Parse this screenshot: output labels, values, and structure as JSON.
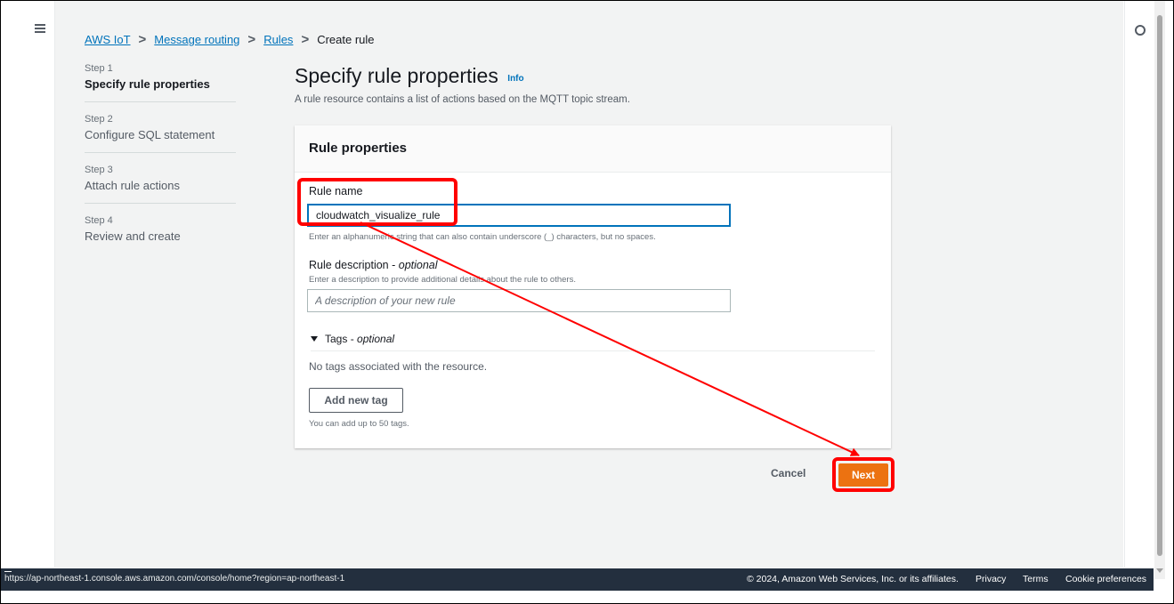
{
  "breadcrumb": {
    "items": [
      "AWS IoT",
      "Message routing",
      "Rules"
    ],
    "current": "Create rule"
  },
  "steps": [
    {
      "num": "Step 1",
      "label": "Specify rule properties",
      "active": true
    },
    {
      "num": "Step 2",
      "label": "Configure SQL statement"
    },
    {
      "num": "Step 3",
      "label": "Attach rule actions"
    },
    {
      "num": "Step 4",
      "label": "Review and create"
    }
  ],
  "page": {
    "title": "Specify rule properties",
    "info": "Info",
    "description": "A rule resource contains a list of actions based on the MQTT topic stream."
  },
  "card": {
    "title": "Rule properties",
    "rule_name_label": "Rule name",
    "rule_name_value": "cloudwatch_visualize_rule",
    "rule_name_hint": "Enter an alphanumeric string that can also contain underscore (_) characters, but no spaces.",
    "desc_label": "Rule description",
    "desc_optional": "optional",
    "desc_hint": "Enter a description to provide additional details about the rule to others.",
    "desc_placeholder": "A description of your new rule",
    "tags_label": "Tags",
    "tags_optional": "optional",
    "no_tags": "No tags associated with the resource.",
    "add_tag": "Add new tag",
    "tag_limit": "You can add up to 50 tags."
  },
  "actions": {
    "cancel": "Cancel",
    "next": "Next"
  },
  "footer": {
    "url": "https://ap-northeast-1.console.aws.amazon.com/console/home?region=ap-northeast-1",
    "copyright": "© 2024, Amazon Web Services, Inc. or its affiliates.",
    "privacy": "Privacy",
    "terms": "Terms",
    "cookies": "Cookie preferences"
  },
  "annotation_color": "#ff0000",
  "accent_color": "#ec7211",
  "icons": [
    "menu-icon",
    "settings-icon",
    "chevron-right-icon",
    "caret-down-icon"
  ]
}
